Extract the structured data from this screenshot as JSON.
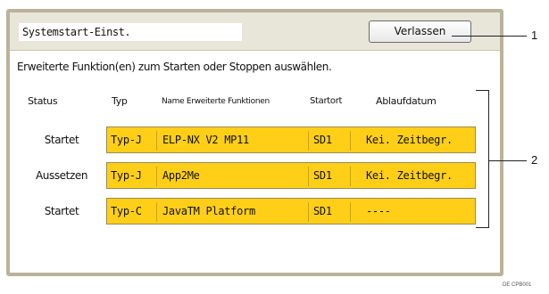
{
  "screen": {
    "title": "Systemstart-Einst.",
    "exit_label": "Verlassen",
    "instruction": "Erweiterte Funktion(en) zum Starten oder Stoppen auswählen."
  },
  "columns": {
    "status": "Status",
    "type": "Typ",
    "name": "Name Erweiterte Funktionen",
    "location": "Startort",
    "expiry": "Ablaufdatum"
  },
  "rows": [
    {
      "status": "Startet",
      "type": "Typ-J",
      "name": "ELP-NX V2 MP11",
      "location": "SD1",
      "expiry": "Kei. Zeitbegr."
    },
    {
      "status": "Aussetzen",
      "type": "Typ-J",
      "name": "App2Me",
      "location": "SD1",
      "expiry": "Kei. Zeitbegr."
    },
    {
      "status": "Startet",
      "type": "Typ-C",
      "name": "JavaTM Platform",
      "location": "SD1",
      "expiry": "----"
    }
  ],
  "callouts": {
    "one": "1",
    "two": "2"
  },
  "footer_code": "DE CPB001"
}
